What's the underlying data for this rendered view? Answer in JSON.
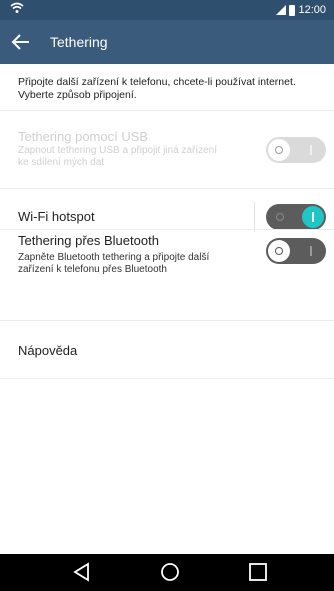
{
  "status_bar": {
    "time": "12:00",
    "icons": [
      "wifi-icon",
      "signal-icon",
      "battery-icon"
    ]
  },
  "action_bar": {
    "title": "Tethering",
    "back_icon": "arrow-left-icon"
  },
  "intro_text": "Připojte další zařízení k telefonu, chcete-li používat internet. Vyberte způsob připojení.",
  "settings": [
    {
      "title": "Tethering pomocí USB",
      "subtitle": "Zapnout tethering USB a připojit jiná zařízení ke sdílení mých dat",
      "enabled": false,
      "state": "off"
    },
    {
      "title": "Wi-Fi hotspot",
      "subtitle": "",
      "enabled": true,
      "state": "on"
    },
    {
      "title": "Tethering přes Bluetooth",
      "subtitle": "Zapněte Bluetooth tethering a připojte další zařízení k telefonu přes Bluetooth",
      "enabled": true,
      "state": "off"
    }
  ],
  "help_label": "Nápověda",
  "nav_bar": {
    "buttons": [
      "back-triangle-icon",
      "home-circle-icon",
      "recents-square-icon"
    ]
  },
  "colors": {
    "status_bar": "#2f4f6e",
    "action_bar": "#3b5b7d",
    "toggle_on_accent": "#1ec6c6",
    "toggle_track": "#5c5c5c"
  }
}
